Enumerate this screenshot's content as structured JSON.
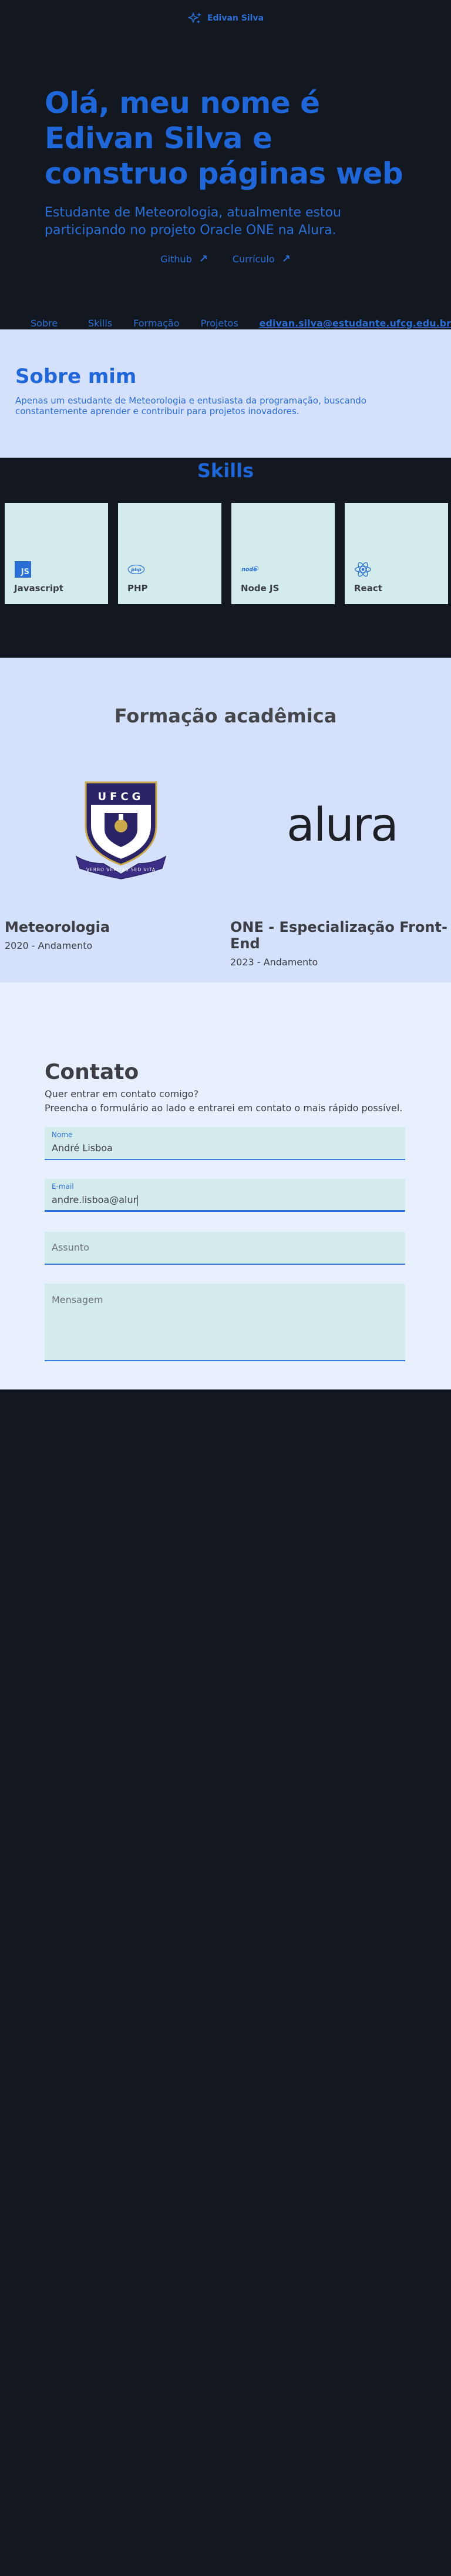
{
  "header": {
    "brand": "Edivan Silva",
    "icon": "sparkle-icon"
  },
  "hero": {
    "title": "Olá, meu nome é Edivan Silva e construo páginas web",
    "subtitle": "Estudante de Meteorologia, atualmente estou participando no projeto Oracle ONE na Alura.",
    "links": [
      {
        "label": "Github",
        "icon": "arrow-up-right-icon"
      },
      {
        "label": "Currículo",
        "icon": "arrow-up-right-icon"
      }
    ]
  },
  "nav": {
    "items": [
      "Sobre mim",
      "Skills",
      "Formação",
      "Projetos"
    ],
    "email": "edivan.silva@estudante.ufcg.edu.br"
  },
  "about": {
    "title": "Sobre mim",
    "text": "Apenas um estudante de Meteorologia e entusiasta da programação, buscando constantemente aprender e contribuir para projetos inovadores."
  },
  "skills": {
    "title": "Skills",
    "items": [
      {
        "name": "Javascript",
        "icon": "javascript-icon",
        "icon_text": "JS"
      },
      {
        "name": "PHP",
        "icon": "php-icon",
        "icon_text": "php"
      },
      {
        "name": "Node JS",
        "icon": "nodejs-icon",
        "icon_text": "node"
      },
      {
        "name": "React",
        "icon": "react-icon"
      }
    ]
  },
  "education": {
    "title": "Formação acadêmica",
    "ufcg_logo": {
      "acronym": "UFCG",
      "motto": "VERBO VERITAS SED VITA"
    },
    "alura_logo": "alura",
    "items": [
      {
        "course": "Meteorologia",
        "period": "2020 - Andamento"
      },
      {
        "course": "ONE - Especialização Front-End",
        "period": "2023 - Andamento"
      }
    ]
  },
  "contact": {
    "title": "Contato",
    "lead_line1": "Quer entrar em contato comigo?",
    "lead_line2": "Preencha o formulário ao lado e entrarei em contato o mais rápido possível.",
    "fields": {
      "name_label": "Nome",
      "name_value": "André Lisboa",
      "email_label": "E-mail",
      "email_value": "andre.lisboa@alur",
      "subject_placeholder": "Assunto",
      "message_placeholder": "Mensagem"
    }
  },
  "colors": {
    "background": "#13171f",
    "accent": "#2b6fd6",
    "section_light": "#d5e0fb",
    "card": "#d4ebeb",
    "contact_bg": "#e8f0fd"
  }
}
